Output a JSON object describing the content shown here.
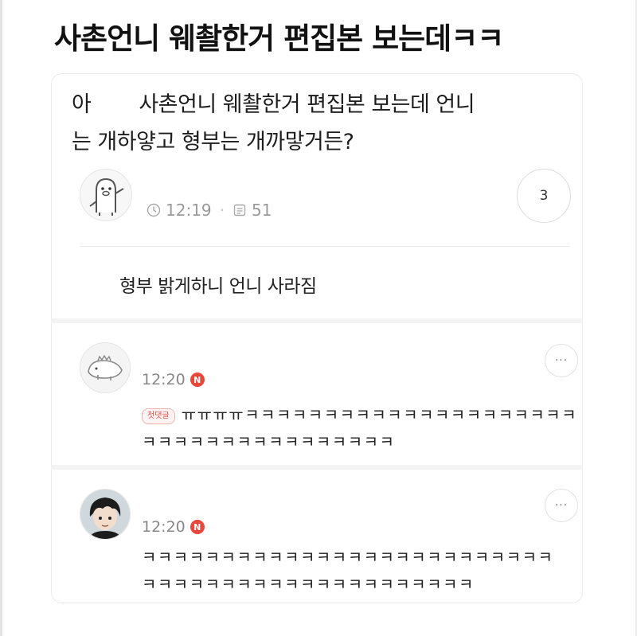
{
  "page": {
    "title": "사촌언니 웨촬한거 편집본 보는데ㅋㅋ"
  },
  "post": {
    "line1_start": "아",
    "line1_rest": "사촌언니 웨촬한거 편집본 보는데 언니",
    "line2": "는 개하얗고 형부는 개까맣거든?",
    "time": "12:19",
    "views": "51",
    "comment_count": "3",
    "reply": "형부 밝게하니 언니 사라짐"
  },
  "comments": [
    {
      "time": "12:20",
      "badge": "N",
      "tag": "첫댓글",
      "line1": "ㅠㅠㅠㅠㅋㅋㅋㅋㅋㅋㅋㅋㅋㅋㅋㅋㅋㅋㅋㅋㅋㅋㅋㅋㅋ",
      "line2": "ㅋㅋㅋㅋㅋㅋㅋㅋㅋㅋㅋㅋㅋㅋㅋㅋ",
      "more": "···"
    },
    {
      "time": "12:20",
      "badge": "N",
      "line1": "ㅋㅋㅋㅋㅋㅋㅋㅋㅋㅋㅋㅋㅋㅋㅋㅋㅋㅋㅋㅋㅋㅋㅋㅋㅋㅋ",
      "line2": "ㅋㅋㅋㅋㅋㅋㅋㅋㅋㅋㅋㅋㅋㅋㅋㅋㅋㅋㅋㅋㅋ",
      "more": "···"
    }
  ],
  "icons": {
    "clock": "clock-icon",
    "views": "document-icon",
    "more": "more-dots-icon",
    "new_badge": "new-badge-icon"
  },
  "colors": {
    "new_badge": "#e8483b",
    "first_tag": "#e0504a"
  }
}
